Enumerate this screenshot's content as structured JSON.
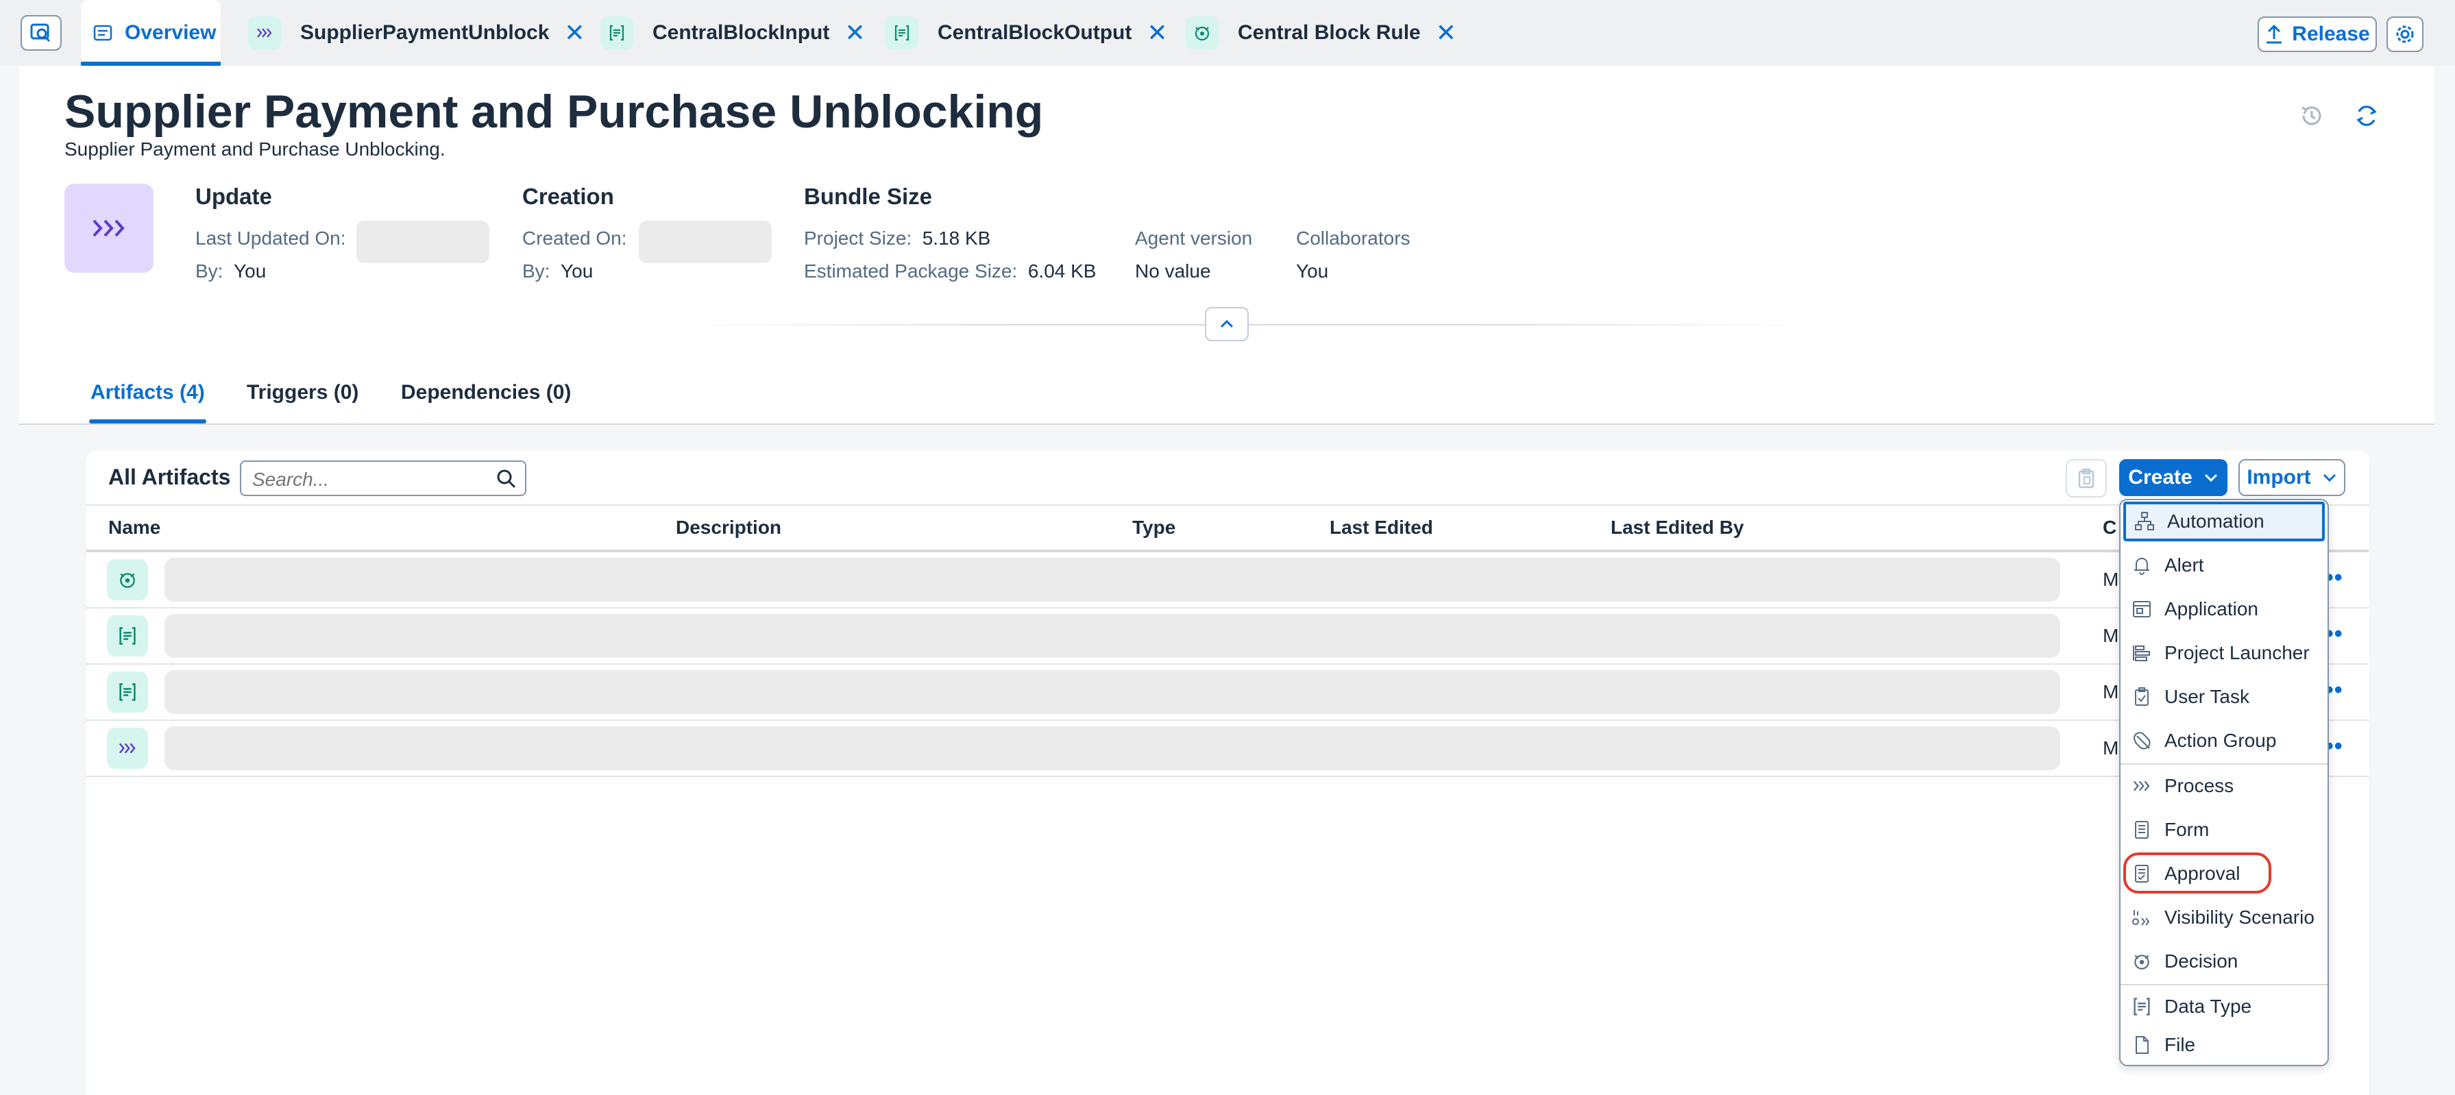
{
  "tabs": [
    {
      "label": "Overview",
      "icon": "overview-icon",
      "active": true
    },
    {
      "label": "SupplierPaymentUnblock",
      "icon": "process-icon",
      "closable": true
    },
    {
      "label": "CentralBlockInput",
      "icon": "data-type-icon",
      "closable": true
    },
    {
      "label": "CentralBlockOutput",
      "icon": "data-type-icon",
      "closable": true
    },
    {
      "label": "Central Block Rule",
      "icon": "decision-icon",
      "closable": true
    }
  ],
  "toolbar": {
    "release_label": "Release"
  },
  "header": {
    "title": "Supplier Payment and Purchase Unblocking",
    "subtitle": "Supplier Payment and Purchase Unblocking.",
    "update": {
      "heading": "Update",
      "last_updated_label": "Last Updated On:",
      "by_label": "By:",
      "by_value": "You"
    },
    "creation": {
      "heading": "Creation",
      "created_label": "Created On:",
      "by_label": "By:",
      "by_value": "You"
    },
    "bundle": {
      "heading": "Bundle Size",
      "project_size_label": "Project Size:",
      "project_size_value": "5.18 KB",
      "package_size_label": "Estimated Package Size:",
      "package_size_value": "6.04 KB"
    },
    "agent": {
      "label": "Agent version",
      "value": "No value"
    },
    "collaborators": {
      "label": "Collaborators",
      "value": "You"
    }
  },
  "section_tabs": [
    "Artifacts (4)",
    "Triggers (0)",
    "Dependencies (0)"
  ],
  "artifacts": {
    "title": "All Artifacts",
    "search_placeholder": "Search...",
    "create_label": "Create",
    "import_label": "Import",
    "columns": [
      "Name",
      "Description",
      "Type",
      "Last Edited",
      "Last Edited By",
      "C"
    ],
    "rows": [
      {
        "icon": "decision-icon",
        "trailing_text": "M"
      },
      {
        "icon": "data-type-icon",
        "trailing_text": "M"
      },
      {
        "icon": "data-type-icon",
        "trailing_text": "M"
      },
      {
        "icon": "process-icon",
        "trailing_text": "M"
      }
    ]
  },
  "create_menu": {
    "items": [
      {
        "label": "Automation",
        "icon": "automation-icon",
        "focused": true
      },
      {
        "label": "Alert",
        "icon": "bell-icon"
      },
      {
        "label": "Application",
        "icon": "application-icon"
      },
      {
        "label": "Project Launcher",
        "icon": "project-launcher-icon"
      },
      {
        "label": "User Task",
        "icon": "user-task-icon"
      },
      {
        "label": "Action Group",
        "icon": "action-group-icon"
      },
      {
        "label": "Process",
        "icon": "process-icon"
      },
      {
        "label": "Form",
        "icon": "form-icon"
      },
      {
        "label": "Approval",
        "icon": "approval-icon",
        "highlighted": true
      },
      {
        "label": "Visibility Scenario",
        "icon": "visibility-scenario-icon"
      },
      {
        "label": "Decision",
        "icon": "decision-icon"
      },
      {
        "label": "Data Type",
        "icon": "data-type-icon"
      },
      {
        "label": "File",
        "icon": "file-icon"
      }
    ]
  },
  "colors": {
    "accent": "#0a6ed1",
    "process_bg": "#e2d8ff",
    "artifact_icon_bg": "#d6f5ef",
    "highlight_ring": "#e23b2e"
  }
}
